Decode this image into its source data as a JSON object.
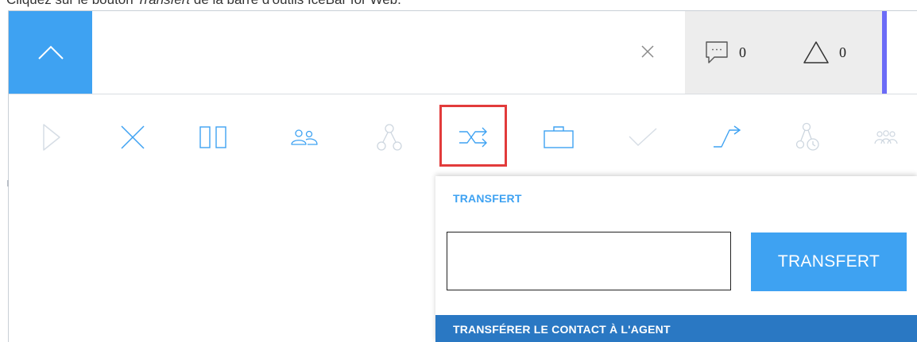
{
  "caption": {
    "prefix": "Cliquez sur le bouton ",
    "button_name": "Transfert",
    "suffix": " de la barre d'outils IceBar for Web."
  },
  "counters": {
    "messages": "0",
    "alerts": "0"
  },
  "toolbar": {
    "items": [
      {
        "icon": "play-icon",
        "enabled": false
      },
      {
        "icon": "close-icon",
        "enabled": true
      },
      {
        "icon": "pause-icon",
        "enabled": true
      },
      {
        "icon": "conference-icon",
        "enabled": true
      },
      {
        "icon": "consult-icon",
        "enabled": false
      },
      {
        "icon": "transfer-icon",
        "enabled": true,
        "highlighted": true
      },
      {
        "icon": "briefcase-icon",
        "enabled": true
      },
      {
        "icon": "checkmark-icon",
        "enabled": false
      },
      {
        "icon": "forward-icon",
        "enabled": true
      },
      {
        "icon": "schedule-icon",
        "enabled": false
      },
      {
        "icon": "group-icon",
        "enabled": false
      }
    ]
  },
  "transfer_panel": {
    "title": "TRANSFERT",
    "input_value": "",
    "button_label": "TRANSFERT",
    "section_label": "TRANSFÉRER LE CONTACT À L'AGENT"
  },
  "colors": {
    "accent": "#3ea2f2",
    "section_bar": "#2a78c3",
    "highlight": "#e23b3b",
    "strip": "#6b6bf7"
  }
}
